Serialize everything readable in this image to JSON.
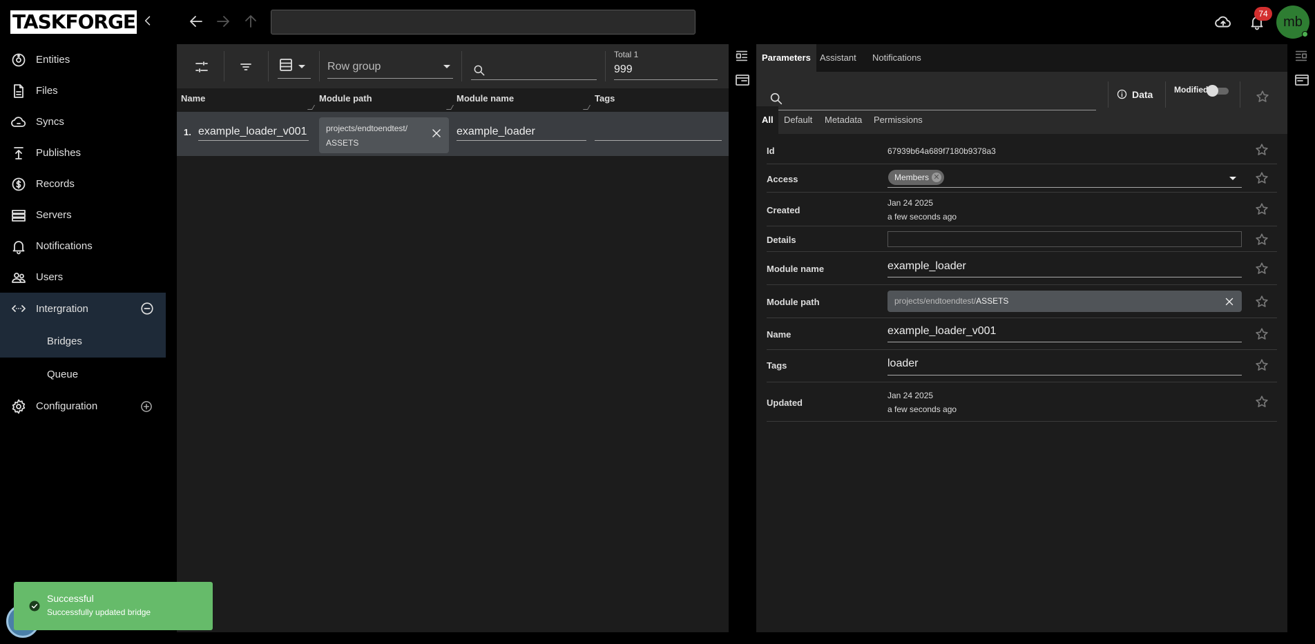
{
  "app": {
    "logo_text": "TASKFORGER"
  },
  "topbar": {
    "address_value": "",
    "notification_count": "74",
    "avatar_initials": "mb"
  },
  "sidebar": {
    "items": [
      {
        "label": "Entities",
        "icon": "entities-icon"
      },
      {
        "label": "Files",
        "icon": "file-icon"
      },
      {
        "label": "Syncs",
        "icon": "cloud-sync-icon"
      },
      {
        "label": "Publishes",
        "icon": "publish-icon"
      },
      {
        "label": "Records",
        "icon": "dollar-circle-icon"
      },
      {
        "label": "Servers",
        "icon": "server-icon"
      },
      {
        "label": "Notifications",
        "icon": "bell-icon"
      },
      {
        "label": "Users",
        "icon": "users-icon"
      },
      {
        "label": "Intergration",
        "icon": "code-arrows-icon"
      },
      {
        "label": "Configuration",
        "icon": "gear-icon"
      }
    ],
    "sub_items": [
      {
        "label": "Bridges"
      },
      {
        "label": "Queue"
      }
    ]
  },
  "grid": {
    "row_group_label": "Row group",
    "total_label": "Total 1",
    "total_value": "999",
    "columns": [
      "Name",
      "Module path",
      "Module name",
      "Tags"
    ],
    "rows": [
      {
        "num": "1.",
        "name": "example_loader_v001",
        "module_path_line1": "projects/endtoendtest/",
        "module_path_line2": "ASSETS",
        "module_name": "example_loader",
        "tags": ""
      }
    ]
  },
  "detail": {
    "tabs": [
      "Parameters",
      "Assistant",
      "Notifications"
    ],
    "active_tab": "Parameters",
    "search_value": "",
    "data_label": "Data",
    "modified_label": "Modified",
    "modified_on": false,
    "sub_tabs": [
      "All",
      "Default",
      "Metadata",
      "Permissions"
    ],
    "properties": {
      "id": {
        "label": "Id",
        "value": "67939b64a689f7180b9378a3"
      },
      "access": {
        "label": "Access",
        "chip": "Members"
      },
      "created": {
        "label": "Created",
        "date": "Jan 24 2025",
        "relative": "a few seconds ago"
      },
      "details": {
        "label": "Details",
        "value": ""
      },
      "module_name": {
        "label": "Module name",
        "value": "example_loader"
      },
      "module_path": {
        "label": "Module path",
        "prefix": "projects/endtoendtest/",
        "value": "ASSETS"
      },
      "name": {
        "label": "Name",
        "value": "example_loader_v001"
      },
      "tags": {
        "label": "Tags",
        "value": "loader"
      },
      "updated": {
        "label": "Updated",
        "date": "Jan 24 2025",
        "relative": "a few seconds ago"
      }
    }
  },
  "toast": {
    "title": "Successful",
    "message": "Successfully updated bridge",
    "color": "#66bb6a"
  }
}
